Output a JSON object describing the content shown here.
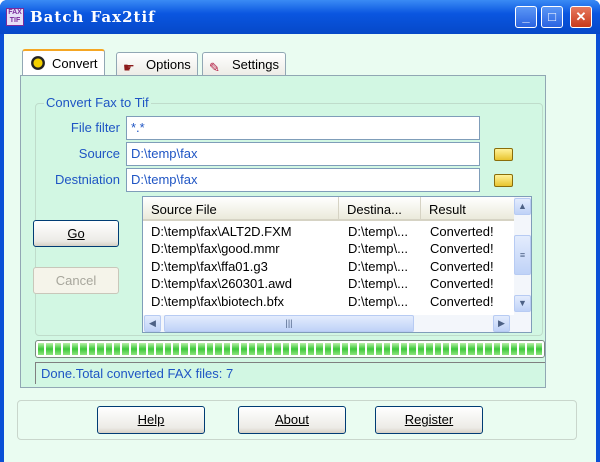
{
  "window": {
    "title": "Batch Fax2tif",
    "app_icon_text": "FAX TIF"
  },
  "tabs": [
    {
      "label": "Convert",
      "active": true
    },
    {
      "label": "Options",
      "active": false
    },
    {
      "label": "Settings",
      "active": false
    }
  ],
  "group": {
    "title": "Convert Fax to Tif",
    "file_filter_label": "File filter",
    "file_filter_value": "*.*",
    "source_label": "Source",
    "source_value": "D:\\temp\\fax",
    "destination_label": "Destniation",
    "destination_value": "D:\\temp\\fax"
  },
  "buttons": {
    "go": "Go",
    "cancel": "Cancel",
    "help": "Help",
    "about": "About",
    "register": "Register"
  },
  "list": {
    "columns": [
      "Source File",
      "Destina...",
      "Result"
    ],
    "rows": [
      {
        "source": "D:\\temp\\fax\\ALT2D.FXM",
        "dest": "D:\\temp\\...",
        "result": "Converted!"
      },
      {
        "source": "D:\\temp\\fax\\good.mmr",
        "dest": "D:\\temp\\...",
        "result": "Converted!"
      },
      {
        "source": "D:\\temp\\fax\\ffa01.g3",
        "dest": "D:\\temp\\...",
        "result": "Converted!"
      },
      {
        "source": "D:\\temp\\fax\\260301.awd",
        "dest": "D:\\temp\\...",
        "result": "Converted!"
      },
      {
        "source": "D:\\temp\\fax\\biotech.bfx",
        "dest": "D:\\temp\\...",
        "result": "Converted!"
      }
    ]
  },
  "progress": {
    "percent": 100
  },
  "status": "Done.Total converted FAX files: 7"
}
